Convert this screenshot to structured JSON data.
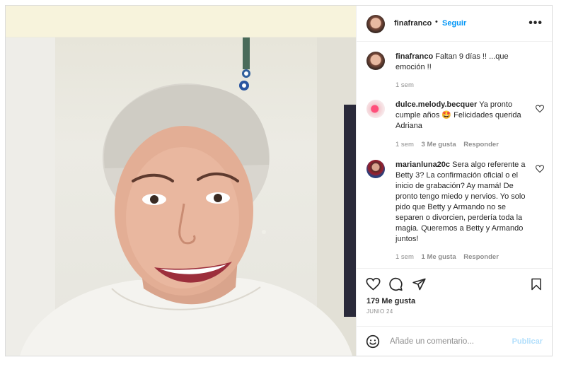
{
  "post": {
    "author": "finafranco",
    "follow_label": "Seguir",
    "separator": "•",
    "more_label": "•••"
  },
  "caption": {
    "username": "finafranco",
    "text": "Faltan 9 días !! ...que emoción !!",
    "time": "1 sem"
  },
  "comments": [
    {
      "username": "dulce.melody.becquer",
      "text": "Ya pronto cumple años 🤩 Felicidades querida Adriana",
      "time": "1 sem",
      "likes": "3 Me gusta",
      "reply_label": "Responder"
    },
    {
      "username": "marianluna20c",
      "text": "Sera algo referente a Betty 3? La confirmación oficial o el inicio de grabación? Ay mamá! De pronto tengo miedo y nervios. Yo solo pido que Betty y Armando no se separen o divorcien, perdería toda la magia. Queremos a Betty y Armando juntos!",
      "time": "1 sem",
      "likes": "1 Me gusta",
      "reply_label": "Responder"
    }
  ],
  "stats": {
    "likes": "179 Me gusta",
    "date": "JUNIO 24"
  },
  "add_comment": {
    "placeholder": "Añade un comentario...",
    "publish_label": "Publicar"
  },
  "colors": {
    "link": "#0095f6",
    "publish_disabled": "#b2dffc",
    "muted": "#8e8e8e"
  },
  "icons": [
    "heart-icon",
    "comment-icon",
    "share-icon",
    "bookmark-icon",
    "emoji-icon",
    "more-icon"
  ]
}
